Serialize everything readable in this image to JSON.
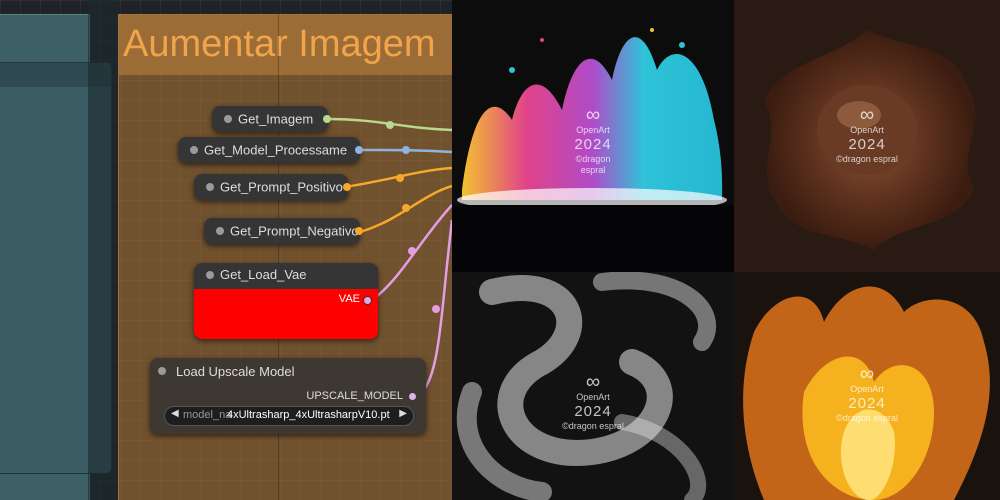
{
  "group": {
    "title": "Aumentar Imagem"
  },
  "nodes": {
    "get_imagem": {
      "title": "Get_Imagem"
    },
    "get_model": {
      "title": "Get_Model_Processame"
    },
    "get_prompt_pos": {
      "title": "Get_Prompt_Positivo"
    },
    "get_prompt_neg": {
      "title": "Get_Prompt_Negativo"
    },
    "get_vae": {
      "title": "Get_Load_Vae",
      "output_label": "VAE"
    },
    "upscale": {
      "title": "Load Upscale Model",
      "output_label": "UPSCALE_MODEL",
      "widget_name": "model_na",
      "widget_value": "4xUltrasharp_4xUltrasharpV10.pt"
    }
  },
  "gallery": {
    "watermark_brand": "OpenArt",
    "watermark_year": "2024",
    "watermark_credit": "©dragon espral",
    "watermark_logo": "infinity-icon",
    "tiles": [
      "paint-splash",
      "chocolate-splash",
      "white-smoke",
      "orange-flame"
    ]
  },
  "colors": {
    "wire_image": "#b9d98f",
    "wire_model": "#8fb3e0",
    "wire_prompt": "#f6a928",
    "wire_vae": "#e39ee4",
    "vae_body": "#ff0000",
    "group_title_text": "#f0a44c"
  }
}
